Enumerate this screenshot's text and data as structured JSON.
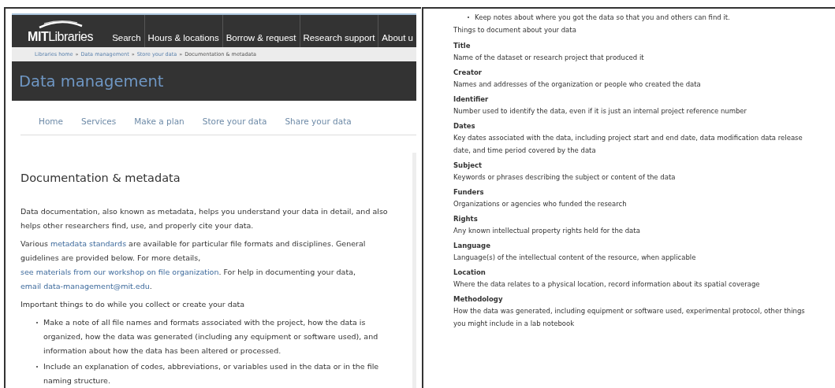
{
  "left_page": {
    "logo": "**MIT**Libraries",
    "top_nav": [
      {
        "label": "Search"
      },
      {
        "label": "Hours & locations"
      },
      {
        "label": "Borrow & request"
      },
      {
        "label": "Research support"
      },
      {
        "label": "About u"
      }
    ],
    "breadcrumb": [
      {
        "label": "Libraries home",
        "link": true,
        "separator": "»"
      },
      {
        "label": "Data management",
        "link": true,
        "separator": "»"
      },
      {
        "label": "Store your data",
        "link": true,
        "separator": "»"
      },
      {
        "label": "Documentation & metadata",
        "link": false
      }
    ],
    "banner_title": "Data management",
    "section_nav": [
      "Home",
      "Services",
      "Make a plan",
      "Store your data",
      "Share your data"
    ],
    "heading": "Documentation & metadata",
    "paragraphs": [
      {
        "segments": [
          {
            "text": "Data documentation, also known as metadata, helps you understand your data in detail, and also helps other researchers find, use, and properly cite your data.",
            "link": false
          }
        ]
      },
      {
        "segments": [
          {
            "text": "Various ",
            "link": false
          },
          {
            "text": "metadata standards",
            "link": true
          },
          {
            "text": " are available for particular file formats and disciplines. General guidelines are provided below. For more details, ",
            "link": false
          },
          {
            "text": "see materials from our workshop on file organization",
            "link": true
          },
          {
            "text": ". For help in documenting your data, ",
            "link": false
          },
          {
            "text": "email data-management@mit.edu",
            "link": true
          },
          {
            "text": ".",
            "link": false
          }
        ]
      },
      {
        "segments": [
          {
            "text": "Important things to do while you collect or create your data",
            "link": false
          }
        ]
      }
    ],
    "bullets": [
      "Make a note of all file names and formats associated with the project, how the data is organized, how the data was generated (including any equipment or software used), and information about how the data has been altered or processed.",
      "Include an explanation of codes, abbreviations, or variables used in the data or in the file naming structure."
    ]
  },
  "right_page": {
    "bullets": [
      "Keep notes about where you got the data so that you and others can find it."
    ],
    "intro": "Things to document about your data",
    "fields": [
      {
        "term": "Title",
        "description": "Name of the dataset or research project that produced it"
      },
      {
        "term": "Creator",
        "description": "Names and addresses of the organization or people who created the data"
      },
      {
        "term": "Identifier",
        "description": "Number used to identify the data, even if it is just an internal project reference number"
      },
      {
        "term": "Dates",
        "description": "Key dates associated with the data, including project start and end date, data modification data release date, and time period covered by the data"
      },
      {
        "term": "Subject",
        "description": "Keywords or phrases describing the subject or content of the data"
      },
      {
        "term": "Funders",
        "description": "Organizations or agencies who funded the research"
      },
      {
        "term": "Rights",
        "description": "Any known intellectual property rights held for the data"
      },
      {
        "term": "Language",
        "description": "Language(s) of the intellectual content of the resource, when applicable"
      },
      {
        "term": "Location",
        "description": "Where the data relates to a physical location, record information about its spatial coverage"
      },
      {
        "term": "Methodology",
        "description": "How the data was generated, including equipment or software used, experimental protocol, other things you might include in a lab notebook"
      }
    ]
  }
}
